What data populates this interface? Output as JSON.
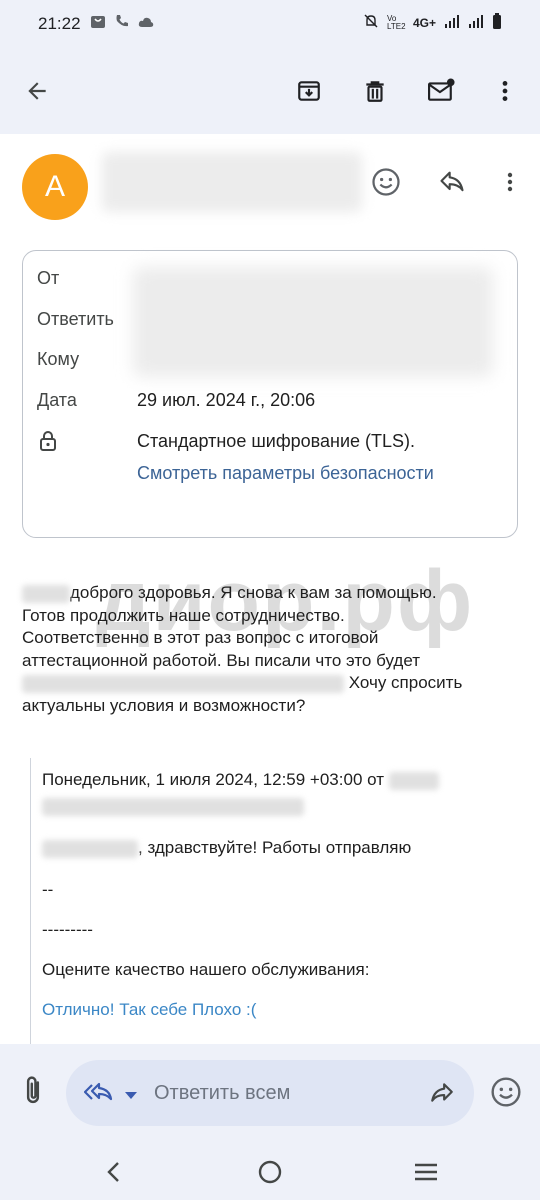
{
  "status_bar": {
    "time": "21:22",
    "network_label": "4G+",
    "volte_label": "Vo LTE2"
  },
  "toolbar": {
    "back_icon": "arrow-left-icon",
    "archive_icon": "archive-icon",
    "delete_icon": "trash-icon",
    "mark_unread_icon": "mail-unread-icon",
    "more_icon": "more-vert-icon"
  },
  "message_header": {
    "avatar_letter": "A",
    "avatar_color": "#f9a11b"
  },
  "details": {
    "from_label": "От",
    "reply_to_label": "Ответить",
    "to_label": "Кому",
    "date_label": "Дата",
    "date_value": "29 июл. 2024 г., 20:06",
    "encryption_value": "Стандартное шифрование (TLS).",
    "security_link": "Смотреть параметры безопасности"
  },
  "body": {
    "line1": "доброго здоровья. Я снова к вам за помощью.",
    "line2": "Готов продолжить наше сотрудничество.",
    "line3": "Соответственно в этот раз вопрос с итоговой",
    "line4": "аттестационной работой. Вы писали что это будет",
    "line5": "Хочу спросить",
    "line6": "актуальны условия и возможности?"
  },
  "watermark": "диор.рф",
  "quoted": {
    "header": "Понедельник, 1 июля 2024, 12:59 +03:00 от",
    "greeting": ", здравствуйте! Работы отправляю",
    "sig1": "--",
    "sig2": "---------",
    "rate_prompt": "Оцените качество нашего обслуживания:",
    "rate_excellent": "Отлично!",
    "rate_ok": "Так себе",
    "rate_bad": "Плохо :("
  },
  "reply_bar": {
    "reply_all_label": "Ответить всем"
  }
}
